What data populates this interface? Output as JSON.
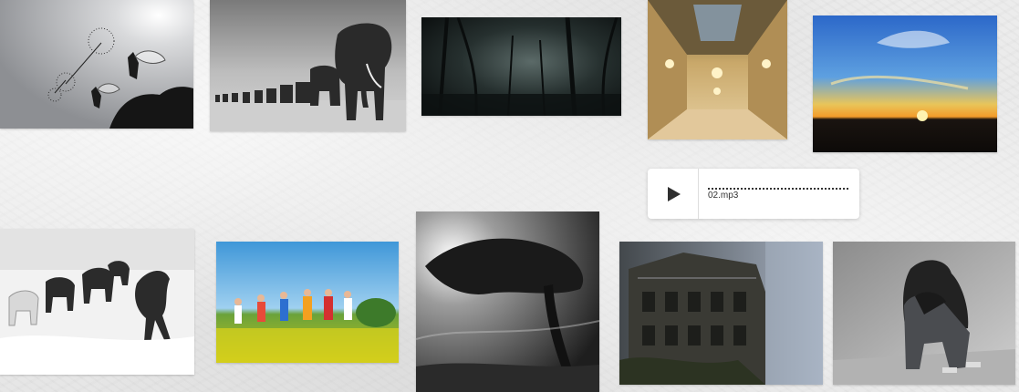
{
  "gallery": {
    "photos": [
      {
        "icon": "fairy-photo-icon"
      },
      {
        "icon": "elephants-photo-icon"
      },
      {
        "icon": "dark-forest-photo-icon"
      },
      {
        "icon": "palace-hall-photo-icon"
      },
      {
        "icon": "sunset-photo-icon"
      },
      {
        "icon": "horses-photo-icon"
      },
      {
        "icon": "children-meadow-photo-icon"
      },
      {
        "icon": "windswept-tree-photo-icon"
      },
      {
        "icon": "abandoned-mansion-photo-icon"
      },
      {
        "icon": "sad-person-photo-icon"
      }
    ]
  },
  "audio_player": {
    "filename": "02.mp3",
    "play_icon": "play-icon",
    "progress": 0
  },
  "colors": {
    "background": "#e9e9e9",
    "player_bg": "#ffffff",
    "play_icon": "#2f2f2f"
  }
}
